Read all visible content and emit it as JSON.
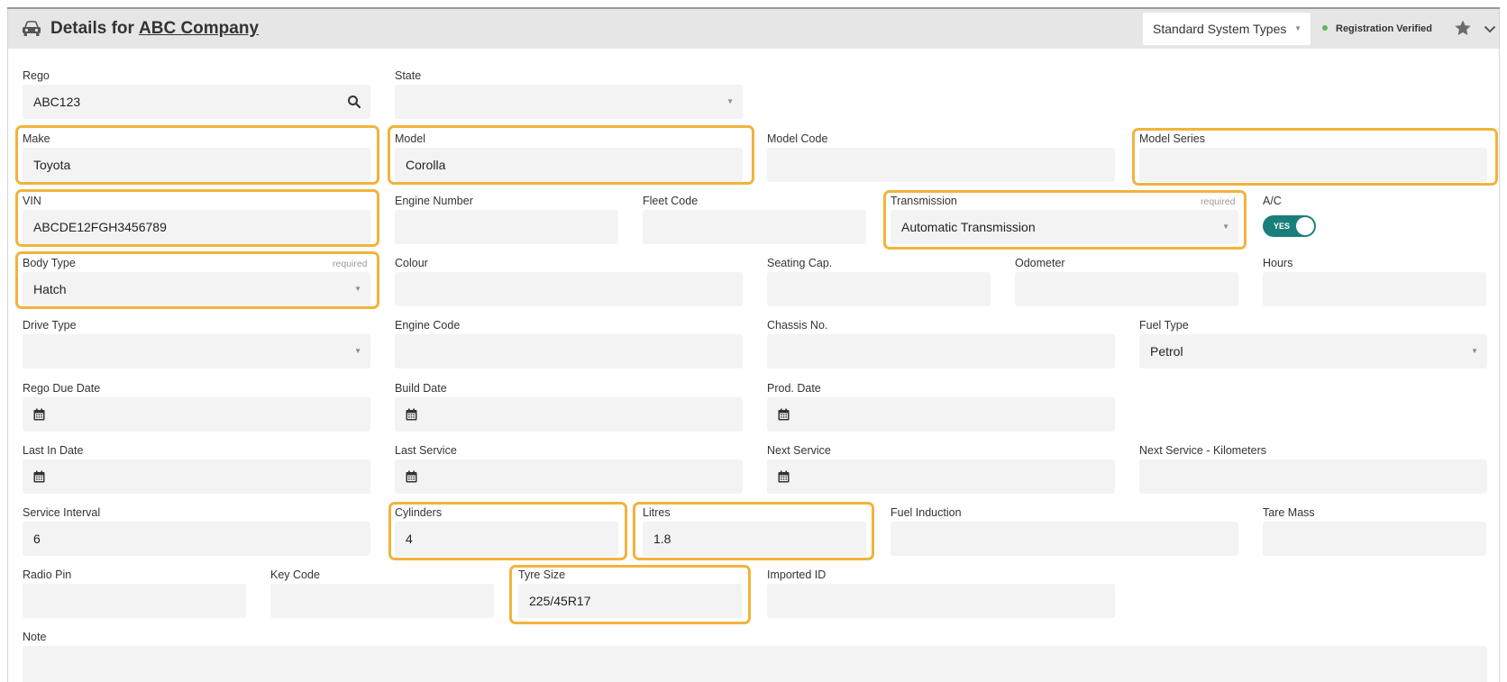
{
  "header": {
    "title_prefix": "Details for",
    "company": "ABC Company",
    "system_types_select": "Standard System Types",
    "registration_status": "Registration Verified"
  },
  "colors": {
    "highlight": "#f2b33c",
    "toggle_on": "#1a7f7a",
    "status_dot": "#5cb85c",
    "header_bg": "#e6e6e6",
    "field_bg": "#f3f3f3"
  },
  "icons": {
    "header": "car-icon",
    "rego_lookup": "search-icon",
    "date_picker": "calendar-icon",
    "favourite": "star-icon",
    "collapse": "chevron-down-icon",
    "select": "caret-down-icon"
  },
  "required_tag": "required",
  "fields": {
    "rego": {
      "label": "Rego",
      "value": "ABC123"
    },
    "state": {
      "label": "State",
      "value": ""
    },
    "make": {
      "label": "Make",
      "value": "Toyota"
    },
    "model": {
      "label": "Model",
      "value": "Corolla"
    },
    "model_code": {
      "label": "Model Code",
      "value": ""
    },
    "model_series": {
      "label": "Model Series",
      "value": ""
    },
    "vin": {
      "label": "VIN",
      "value": "ABCDE12FGH3456789"
    },
    "engine_number": {
      "label": "Engine Number",
      "value": ""
    },
    "fleet_code": {
      "label": "Fleet Code",
      "value": ""
    },
    "transmission": {
      "label": "Transmission",
      "value": "Automatic Transmission"
    },
    "ac": {
      "label": "A/C",
      "value": "YES"
    },
    "body_type": {
      "label": "Body Type",
      "value": "Hatch"
    },
    "colour": {
      "label": "Colour",
      "value": ""
    },
    "seating_cap": {
      "label": "Seating Cap.",
      "value": ""
    },
    "odometer": {
      "label": "Odometer",
      "value": ""
    },
    "hours": {
      "label": "Hours",
      "value": ""
    },
    "drive_type": {
      "label": "Drive Type",
      "value": ""
    },
    "engine_code": {
      "label": "Engine Code",
      "value": ""
    },
    "chassis_no": {
      "label": "Chassis No.",
      "value": ""
    },
    "fuel_type": {
      "label": "Fuel Type",
      "value": "Petrol"
    },
    "rego_due_date": {
      "label": "Rego Due Date",
      "value": ""
    },
    "build_date": {
      "label": "Build Date",
      "value": ""
    },
    "prod_date": {
      "label": "Prod. Date",
      "value": ""
    },
    "last_in_date": {
      "label": "Last In Date",
      "value": ""
    },
    "last_service": {
      "label": "Last Service",
      "value": ""
    },
    "next_service": {
      "label": "Next Service",
      "value": ""
    },
    "next_service_km": {
      "label": "Next Service - Kilometers",
      "value": ""
    },
    "service_interval": {
      "label": "Service Interval",
      "value": "6"
    },
    "cylinders": {
      "label": "Cylinders",
      "value": "4"
    },
    "litres": {
      "label": "Litres",
      "value": "1.8"
    },
    "fuel_induction": {
      "label": "Fuel Induction",
      "value": ""
    },
    "tare_mass": {
      "label": "Tare Mass",
      "value": ""
    },
    "radio_pin": {
      "label": "Radio Pin",
      "value": ""
    },
    "key_code": {
      "label": "Key Code",
      "value": ""
    },
    "tyre_size": {
      "label": "Tyre Size",
      "value": "225/45R17"
    },
    "imported_id": {
      "label": "Imported ID",
      "value": ""
    },
    "note": {
      "label": "Note",
      "value": ""
    }
  }
}
